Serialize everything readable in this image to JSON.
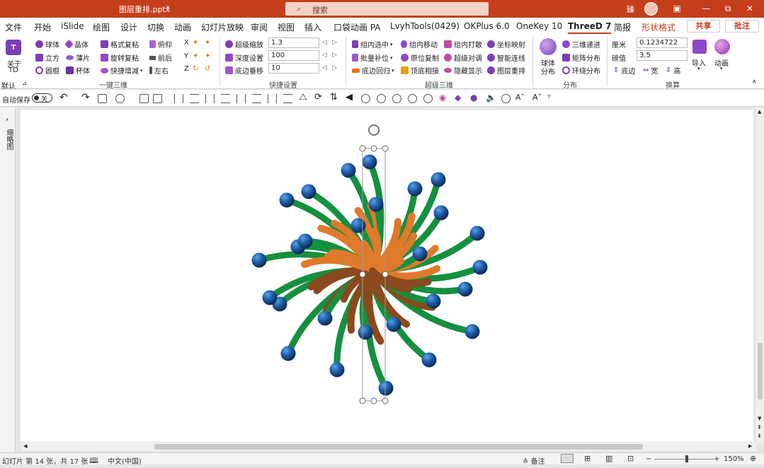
{
  "titlebar": {
    "filename": "图层重排.pptx",
    "search_placeholder": "搜索",
    "user_initial": "臻",
    "minimize": "—",
    "restore": "⧉",
    "close": "✕",
    "accent": "#c43e1c"
  },
  "menu": {
    "items": [
      "文件",
      "开始",
      "iSlide",
      "绘图",
      "设计",
      "切换",
      "动画",
      "幻灯片放映",
      "审阅",
      "视图",
      "插入",
      "口袋动画 PA",
      "LvyhTools(0429)",
      "OKPlus 6.0",
      "OneKey 10",
      "ThreeD 7",
      "简报",
      "形状格式"
    ],
    "share": "共享",
    "comment": "批注"
  },
  "ribbon": {
    "about": {
      "line1": "关于",
      "line2": "TD"
    },
    "default_label": "默认",
    "shapes": [
      "球体",
      "晶体",
      "立方",
      "薄片",
      "圆棍",
      "杯体"
    ],
    "format": [
      "格式复粘",
      "旋转复粘",
      "快捷增减"
    ],
    "view": [
      "俯仰",
      "前后",
      "左右"
    ],
    "axis": [
      "X",
      "Y",
      "Z"
    ],
    "group1": "一键三维",
    "quick": {
      "labels": [
        "超级缩放",
        "深度设置",
        "底边垂移"
      ],
      "values": [
        "1.3",
        "100",
        "10"
      ]
    },
    "group2": "快捷设置",
    "super3d": [
      [
        "组内选中",
        "组内移动",
        "组内打散",
        "坐标映射"
      ],
      [
        "批量补位",
        "原位复制",
        "超级对调",
        "智能连线"
      ],
      [
        "底边回归",
        "顶底相接",
        "隐藏显示",
        "图层重排"
      ]
    ],
    "group3": "超级三维",
    "dist_big": {
      "line1": "球体",
      "line2": "分布"
    },
    "dist": [
      "三维递进",
      "矩阵分布",
      "环绕分布"
    ],
    "group4": "分布",
    "convert": {
      "labels": [
        "厘米",
        "磅值"
      ],
      "values": [
        "0.1234722",
        "3.5"
      ],
      "buttons": [
        "底边",
        "宽",
        "高"
      ]
    },
    "group5": "换算",
    "import": "导入",
    "animate": "动画"
  },
  "qat": {
    "autosave": "自动保存",
    "toggle": "关"
  },
  "leftpane": {
    "label": "缩略图"
  },
  "status": {
    "slide": "幻灯片 第 14 张，共 17 张",
    "lang": "中文(中国)",
    "notes": "备注",
    "zoom": "150%"
  },
  "colors": {
    "green": "#15903f",
    "orange": "#e07a2a",
    "brown": "#8a4a1e",
    "ball": "#1f5fa8"
  }
}
